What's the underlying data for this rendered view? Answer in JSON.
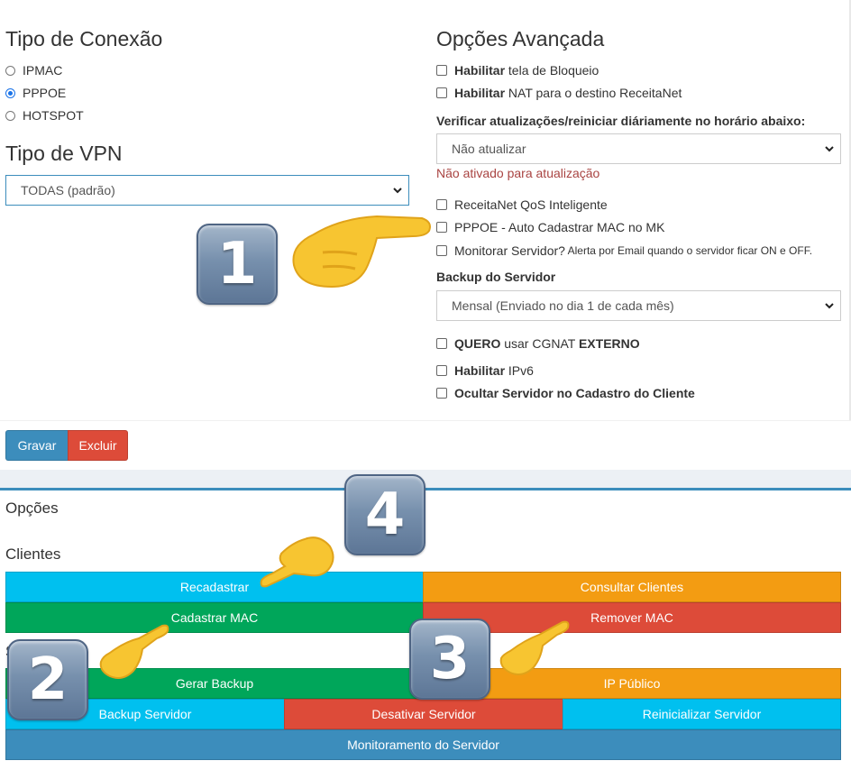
{
  "conexao": {
    "title": "Tipo de Conexão",
    "options": [
      "IPMAC",
      "PPPOE",
      "HOTSPOT"
    ],
    "selected": "PPPOE"
  },
  "vpn": {
    "title": "Tipo de VPN",
    "selected": "TODAS (padrão)"
  },
  "avancada": {
    "title": "Opções Avançada",
    "bloqueio_bold": "Habilitar",
    "bloqueio_rest": " tela de Bloqueio",
    "nat_bold": "Habilitar",
    "nat_rest": " NAT para o destino ReceitaNet",
    "atualizar_label": "Verificar atualizações/reiniciar diáriamente no horário abaixo:",
    "atualizar_selected": "Não atualizar",
    "atualizar_warning": "Não ativado para atualização",
    "qos": "ReceitaNet QoS Inteligente",
    "pppoe_mac": "PPPOE - Auto Cadastrar MAC no MK",
    "monitorar": "Monitorar Servidor?",
    "monitorar_hint": " Alerta por Email quando o servidor ficar ON e OFF.",
    "backup_label": "Backup do Servidor",
    "backup_selected": "Mensal (Enviado no dia 1 de cada mês)",
    "cgnat_bold1": "QUERO",
    "cgnat_mid": " usar CGNAT ",
    "cgnat_bold2": "EXTERNO",
    "ipv6_bold": "Habilitar",
    "ipv6_rest": " IPv6",
    "ocultar": "Ocultar Servidor no Cadastro do Cliente"
  },
  "actions": {
    "gravar": "Gravar",
    "excluir": "Excluir"
  },
  "opcoes": {
    "title": "Opções",
    "clientes_title": "Clientes",
    "servidor_title_partial": "S",
    "buttons": {
      "recadastrar": "Recadastrar",
      "consultar": "Consultar Clientes",
      "cadastrar_mac": "Cadastrar MAC",
      "remover_mac": "Remover MAC",
      "gerar_backup": "Gerar Backup",
      "ip_publico": "IP Público",
      "backup_servidor": "Backup Servidor",
      "desativar": "Desativar Servidor",
      "reinicializar": "Reinicializar Servidor",
      "monitoramento": "Monitoramento do Servidor"
    }
  },
  "annotations": [
    "1",
    "2",
    "3",
    "4"
  ],
  "colors": {
    "aqua": "#00c0ef",
    "orange": "#f39c12",
    "green": "#00a65a",
    "red": "#dd4b39",
    "blue": "#3c8dbc"
  }
}
